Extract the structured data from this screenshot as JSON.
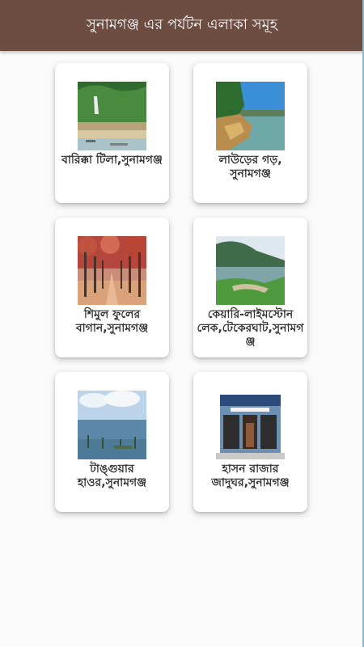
{
  "app_bar": {
    "title": "সুনামগঞ্জ এর পর্যটন এলাকা সমূহ"
  },
  "places": [
    {
      "label": "বারিক্কা টিলা,সুনামগঞ্জ",
      "image": "waterfall-hills-photo"
    },
    {
      "label": "লাউড়ের গড়, সুনামগঞ্জ",
      "image": "river-bank-photo"
    },
    {
      "label": "শিমুল ফুলের বাগান,সুনামগঞ্জ",
      "image": "shimul-garden-photo"
    },
    {
      "label": "কেয়ারি-লাইমস্টোন লেক,টেকেরঘাট,সুনামগঞ্জ",
      "image": "limestone-lake-photo"
    },
    {
      "label": "টাঙ্গুয়ার হাওর,সুনামগঞ্জ",
      "image": "haor-wetland-photo"
    },
    {
      "label": "হাসন রাজার জাদুঘর,সুনামগঞ্জ",
      "image": "museum-building-photo"
    }
  ],
  "colors": {
    "app_bar": "#6d4c41",
    "background": "#fafafa",
    "card": "#ffffff",
    "label_text": "#333333"
  }
}
